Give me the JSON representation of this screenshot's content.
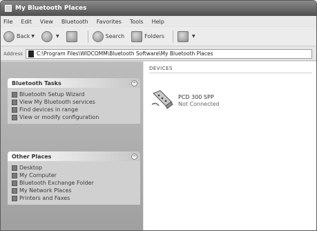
{
  "window": {
    "title": "My Bluetooth Places"
  },
  "menu": [
    "File",
    "Edit",
    "View",
    "Bluetooth",
    "Favorites",
    "Tools",
    "Help"
  ],
  "toolbar": {
    "back": "Back",
    "search": "Search",
    "folders": "Folders"
  },
  "address": {
    "label": "Address",
    "value": "C:\\Program Files\\WIDCOMM\\Bluetooth Software\\My Bluetooth Places"
  },
  "bluetooth_tasks": {
    "title": "Bluetooth Tasks",
    "items": [
      "Bluetooth Setup Wizard",
      "View My Bluetooth services",
      "Find devices in range",
      "View or modify configuration"
    ]
  },
  "other_places": {
    "title": "Other Places",
    "items": [
      "Desktop",
      "My Computer",
      "Bluetooth Exchange Folder",
      "My Network Places",
      "Printers and Faxes"
    ]
  },
  "content": {
    "column_header": "DEVICES",
    "device": {
      "name": "PCD 300 SPP",
      "status": "Not Connected"
    }
  }
}
